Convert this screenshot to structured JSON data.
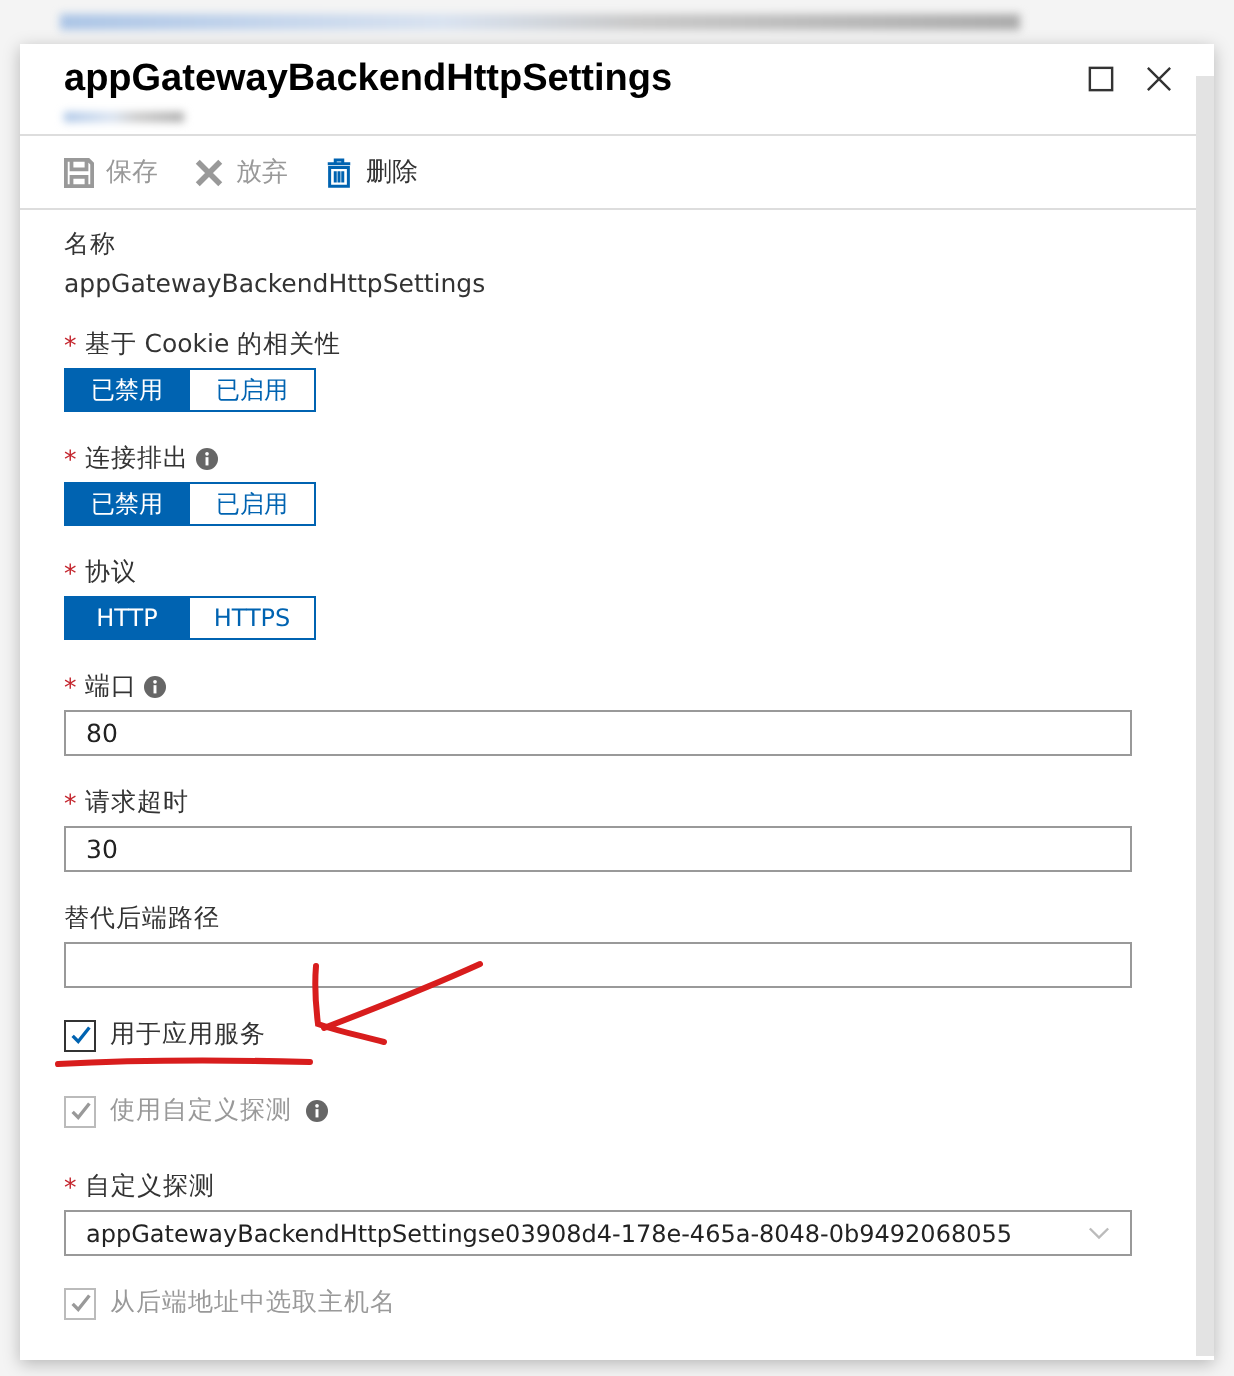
{
  "title": "appGatewayBackendHttpSettings",
  "toolbar": [
    {
      "kind": "save",
      "label": "保存",
      "disabled": true
    },
    {
      "kind": "discard",
      "label": "放弃",
      "disabled": true
    },
    {
      "kind": "delete",
      "label": "删除",
      "disabled": false
    }
  ],
  "fields": [
    {
      "kind": "text",
      "label": "名称",
      "value": "appGatewayBackendHttpSettings"
    },
    {
      "kind": "toggle",
      "label": "基于 Cookie 的相关性",
      "required": "*",
      "info": false,
      "options": [
        {
          "label": "已禁用",
          "selected": true
        },
        {
          "label": "已启用",
          "selected": false
        }
      ]
    },
    {
      "kind": "toggle",
      "label": "连接排出",
      "required": "*",
      "info": true,
      "options": [
        {
          "label": "已禁用",
          "selected": true
        },
        {
          "label": "已启用",
          "selected": false
        }
      ]
    },
    {
      "kind": "toggle",
      "label": "协议",
      "required": "*",
      "info": false,
      "options": [
        {
          "label": "HTTP",
          "selected": true
        },
        {
          "label": "HTTPS",
          "selected": false
        }
      ]
    },
    {
      "kind": "input",
      "label": "端口",
      "required": "*",
      "info": true,
      "value": "80"
    },
    {
      "kind": "input",
      "label": "请求超时",
      "required": "*",
      "info": false,
      "value": "30"
    },
    {
      "kind": "input",
      "label": "替代后端路径",
      "info": false
    },
    {
      "kind": "checkbox",
      "label": "用于应用服务",
      "checked": true,
      "disabled": false,
      "info": false
    },
    {
      "kind": "checkbox",
      "label": "使用自定义探测",
      "checked": true,
      "disabled": true,
      "info": true
    },
    {
      "kind": "select",
      "label": "自定义探测",
      "required": "*",
      "info": false,
      "value": "appGatewayBackendHttpSettingse03908d4-178e-465a-8048-0b9492068055"
    },
    {
      "kind": "checkbox",
      "label": "从后端地址中选取主机名",
      "checked": true,
      "disabled": true,
      "info": false
    }
  ]
}
